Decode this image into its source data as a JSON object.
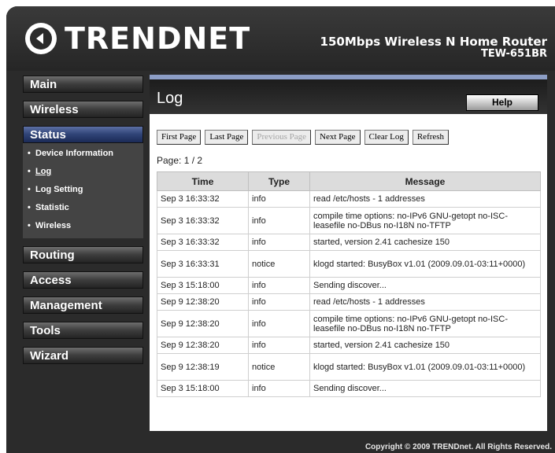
{
  "brand": {
    "logo_text": "TRENDNET"
  },
  "product": {
    "name": "150Mbps Wireless N Home Router",
    "model": "TEW-651BR"
  },
  "menu": {
    "main": "Main",
    "wireless": "Wireless",
    "status": "Status",
    "status_items": [
      {
        "label": "Device Information"
      },
      {
        "label": "Log"
      },
      {
        "label": "Log Setting"
      },
      {
        "label": "Statistic"
      },
      {
        "label": "Wireless"
      }
    ],
    "routing": "Routing",
    "access": "Access",
    "management": "Management",
    "tools": "Tools",
    "wizard": "Wizard"
  },
  "page": {
    "title": "Log",
    "help": "Help",
    "page_indicator": "Page: 1 / 2"
  },
  "toolbar": {
    "first": "First Page",
    "last": "Last Page",
    "previous": "Previous Page",
    "next": "Next Page",
    "clear": "Clear Log",
    "refresh": "Refresh"
  },
  "table": {
    "headers": {
      "time": "Time",
      "type": "Type",
      "message": "Message"
    },
    "rows": [
      {
        "time": "Sep 3 16:33:32",
        "type": "info",
        "message": "read /etc/hosts - 1 addresses"
      },
      {
        "time": "Sep 3 16:33:32",
        "type": "info",
        "message": "compile time options: no-IPv6 GNU-getopt no-ISC-leasefile no-DBus no-I18N no-TFTP"
      },
      {
        "time": "Sep 3 16:33:32",
        "type": "info",
        "message": "started, version 2.41 cachesize 150"
      },
      {
        "time": "Sep 3 16:33:31",
        "type": "notice",
        "message": "klogd started: BusyBox v1.01 (2009.09.01-03:11+0000)"
      },
      {
        "time": "Sep 3 15:18:00",
        "type": "info",
        "message": "Sending discover..."
      },
      {
        "time": "Sep 9 12:38:20",
        "type": "info",
        "message": "read /etc/hosts - 1 addresses"
      },
      {
        "time": "Sep 9 12:38:20",
        "type": "info",
        "message": "compile time options: no-IPv6 GNU-getopt no-ISC-leasefile no-DBus no-I18N no-TFTP"
      },
      {
        "time": "Sep 9 12:38:20",
        "type": "info",
        "message": "started, version 2.41 cachesize 150"
      },
      {
        "time": "Sep 9 12:38:19",
        "type": "notice",
        "message": "klogd started: BusyBox v1.01 (2009.09.01-03:11+0000)"
      },
      {
        "time": "Sep 3 15:18:00",
        "type": "info",
        "message": "Sending discover..."
      }
    ]
  },
  "footer": {
    "copyright": "Copyright © 2009 TRENDnet. All Rights Reserved."
  },
  "colors": {
    "active_menu": "#2f4376",
    "header_strip": "#8d9ec6",
    "frame": "#2b2b2b"
  }
}
